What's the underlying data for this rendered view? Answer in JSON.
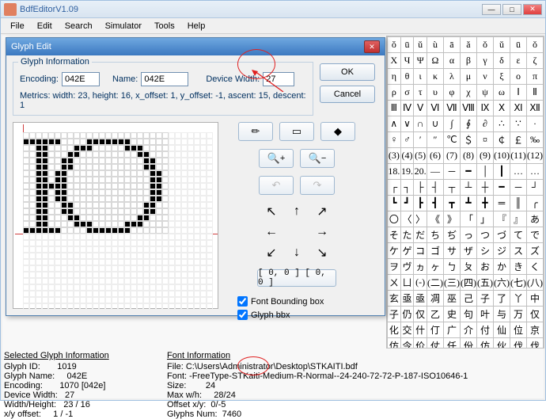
{
  "app": {
    "title": "BdfEditorV1.09"
  },
  "menu": [
    "File",
    "Edit",
    "Search",
    "Simulator",
    "Tools",
    "Help"
  ],
  "dialog": {
    "title": "Glyph Edit",
    "group_label": "Glyph Information",
    "encoding_label": "Encoding:",
    "encoding_value": "042E",
    "name_label": "Name:",
    "name_value": "042E",
    "dwidth_label": "Device Width:",
    "dwidth_value": "27",
    "metrics": "Metrics: width: 23, height: 16, x_offset: 1, y_offset: -1, ascent: 15, descent: 1",
    "ok": "OK",
    "cancel": "Cancel",
    "origin_label": "[ 0, 0 ] [ 0, 0 ]",
    "chk1": "Font Bounding box",
    "chk2": "Glyph bbx",
    "icons": {
      "pencil": "✏",
      "rect": "▭",
      "eraser": "◆",
      "zoom_in": "🔍+",
      "zoom_out": "🔍−",
      "undo": "↶",
      "redo": "↷"
    },
    "arrows": {
      "nw": "↖",
      "n": "↑",
      "ne": "↗",
      "w": "←",
      "e": "→",
      "sw": "↙",
      "s": "↓",
      "se": "↘"
    }
  },
  "palette_rows": [
    [
      "ŏ",
      "ū",
      "ǔ",
      "ù",
      "ā",
      "ǎ",
      "ǒ",
      "ǔ",
      "ū",
      "ǒ"
    ],
    [
      "X",
      "Ч",
      "Ψ",
      "Ω",
      "α",
      "β",
      "γ",
      "δ",
      "ε",
      "ζ"
    ],
    [
      "η",
      "θ",
      "ι",
      "κ",
      "λ",
      "μ",
      "ν",
      "ξ",
      "ο",
      "π"
    ],
    [
      "ρ",
      "σ",
      "τ",
      "υ",
      "φ",
      "χ",
      "ψ",
      "ω",
      "Ⅰ",
      "Ⅱ"
    ],
    [
      "Ⅲ",
      "Ⅳ",
      "Ⅴ",
      "Ⅵ",
      "Ⅶ",
      "Ⅷ",
      "Ⅸ",
      "Ⅹ",
      "Ⅺ",
      "Ⅻ"
    ],
    [
      "∧",
      "∨",
      "∩",
      "∪",
      "∫",
      "∮",
      "∂",
      "∴",
      "∵",
      "·"
    ],
    [
      "♀",
      "♂",
      "′",
      "″",
      "℃",
      "＄",
      "¤",
      "￠",
      "￡",
      "‰"
    ],
    [
      "(3)",
      "(4)",
      "(5)",
      "(6)",
      "(7)",
      "(8)",
      "(9)",
      "(10)",
      "(11)",
      "(12)"
    ],
    [
      "18.",
      "19.",
      "20.",
      "—",
      "─",
      "━",
      "│",
      "┃",
      "…",
      "…"
    ],
    [
      "┌",
      "┐",
      "├",
      "┤",
      "┬",
      "┴",
      "┼",
      "━",
      "─",
      "┘"
    ],
    [
      "┗",
      "┛",
      "┣",
      "┫",
      "┳",
      "┻",
      "╋",
      "═",
      "║",
      "╭"
    ],
    [
      "〇",
      "〈",
      "〉",
      "《",
      "》",
      "「",
      "」",
      "『",
      "』",
      "あ"
    ],
    [
      "そ",
      "た",
      "だ",
      "ち",
      "ぢ",
      "っ",
      "つ",
      "づ",
      "て",
      "で"
    ],
    [
      "ケ",
      "ゲ",
      "コ",
      "ゴ",
      "サ",
      "ザ",
      "シ",
      "ジ",
      "ス",
      "ズ"
    ],
    [
      "ヲ",
      "ヴ",
      "ヵ",
      "ヶ",
      "ㄅ",
      "ㄆ",
      "お",
      "か",
      "き",
      "く"
    ],
    [
      "ㄨ",
      "ㄩ",
      "(-)",
      "(二)",
      "(三)",
      "(四)",
      "(五)",
      "(六)",
      "(七)",
      "(八)"
    ],
    [
      "玄",
      "亟",
      "亟",
      "凋",
      "巫",
      "己",
      "子",
      "了",
      "丫",
      "中"
    ],
    [
      "子",
      "仍",
      "仅",
      "乙",
      "史",
      "句",
      "叶",
      "与",
      "万",
      "仅"
    ],
    [
      "化",
      "交",
      "什",
      "仃",
      "广",
      "介",
      "付",
      "仙",
      "位",
      "京"
    ],
    [
      "仿",
      "令",
      "价",
      "仗",
      "任",
      "份",
      "仿",
      "伙",
      "伐",
      "伐"
    ]
  ],
  "selected_info": {
    "header": "Selected Glyph Information",
    "glyph_id": "Glyph ID:       1019",
    "glyph_name": "Glyph Name:     042E",
    "encoding": "Encoding:       1070 [042e]",
    "dwidth": "Device Width:   27",
    "wh": "Width/Height:   23 / 16",
    "offset": "x/y offset:     1 / -1"
  },
  "font_info": {
    "header": "Font Information",
    "file": "File: C:\\Users\\Administrator\\Desktop\\STKAITI.bdf",
    "font": "Font: -FreeType-STKaiti-Medium-R-Normal--24-240-72-72-P-187-ISO10646-1",
    "size": "Size:        24",
    "max_wh": "Max w/h:     28/24",
    "offset": "Offset x/y:  0/-5",
    "glyphs": "Glyphs Num:  7460"
  },
  "glyph_pixels": [
    [
      0,
      0,
      0,
      0,
      0,
      0,
      0,
      0,
      0,
      0,
      0,
      0,
      0,
      0,
      0,
      0,
      0,
      0,
      0,
      0,
      0,
      0,
      0
    ],
    [
      1,
      1,
      1,
      1,
      1,
      1,
      0,
      0,
      0,
      0,
      1,
      1,
      1,
      1,
      1,
      1,
      1,
      0,
      0,
      0,
      0,
      0,
      0
    ],
    [
      0,
      0,
      1,
      1,
      0,
      0,
      0,
      0,
      1,
      1,
      1,
      0,
      0,
      0,
      0,
      0,
      1,
      1,
      1,
      0,
      0,
      0,
      0
    ],
    [
      0,
      0,
      1,
      1,
      0,
      0,
      0,
      1,
      1,
      0,
      0,
      0,
      0,
      0,
      0,
      0,
      0,
      0,
      1,
      1,
      0,
      0,
      0
    ],
    [
      0,
      0,
      1,
      1,
      0,
      0,
      1,
      1,
      0,
      0,
      0,
      0,
      0,
      0,
      0,
      0,
      0,
      0,
      0,
      1,
      1,
      0,
      0
    ],
    [
      0,
      0,
      1,
      1,
      0,
      0,
      1,
      1,
      0,
      0,
      0,
      0,
      0,
      0,
      0,
      0,
      0,
      0,
      0,
      1,
      1,
      0,
      0
    ],
    [
      0,
      0,
      1,
      1,
      0,
      1,
      1,
      0,
      0,
      0,
      0,
      0,
      0,
      0,
      0,
      0,
      0,
      0,
      0,
      0,
      1,
      1,
      0
    ],
    [
      0,
      0,
      1,
      1,
      0,
      1,
      1,
      0,
      0,
      0,
      0,
      0,
      0,
      0,
      0,
      0,
      0,
      0,
      0,
      0,
      1,
      1,
      0
    ],
    [
      0,
      0,
      1,
      1,
      1,
      1,
      1,
      0,
      0,
      0,
      0,
      0,
      0,
      0,
      0,
      0,
      0,
      0,
      0,
      0,
      1,
      1,
      0
    ],
    [
      0,
      0,
      1,
      1,
      0,
      1,
      1,
      0,
      0,
      0,
      0,
      0,
      0,
      0,
      0,
      0,
      0,
      0,
      0,
      0,
      1,
      1,
      0
    ],
    [
      0,
      0,
      1,
      1,
      0,
      1,
      1,
      0,
      0,
      0,
      0,
      0,
      0,
      0,
      0,
      0,
      0,
      0,
      0,
      0,
      1,
      1,
      0
    ],
    [
      0,
      0,
      1,
      1,
      0,
      0,
      1,
      1,
      0,
      0,
      0,
      0,
      0,
      0,
      0,
      0,
      0,
      0,
      0,
      1,
      1,
      0,
      0
    ],
    [
      0,
      0,
      1,
      1,
      0,
      0,
      1,
      1,
      0,
      0,
      0,
      0,
      0,
      0,
      0,
      0,
      0,
      0,
      0,
      1,
      1,
      0,
      0
    ],
    [
      0,
      0,
      1,
      1,
      0,
      0,
      0,
      1,
      1,
      0,
      0,
      0,
      0,
      0,
      0,
      0,
      0,
      0,
      1,
      1,
      0,
      0,
      0
    ],
    [
      0,
      0,
      1,
      1,
      0,
      0,
      0,
      0,
      1,
      1,
      1,
      0,
      0,
      0,
      0,
      0,
      1,
      1,
      1,
      0,
      0,
      0,
      0
    ],
    [
      1,
      1,
      1,
      1,
      1,
      1,
      0,
      0,
      0,
      0,
      1,
      1,
      1,
      1,
      1,
      1,
      1,
      0,
      0,
      0,
      0,
      0,
      0
    ]
  ]
}
